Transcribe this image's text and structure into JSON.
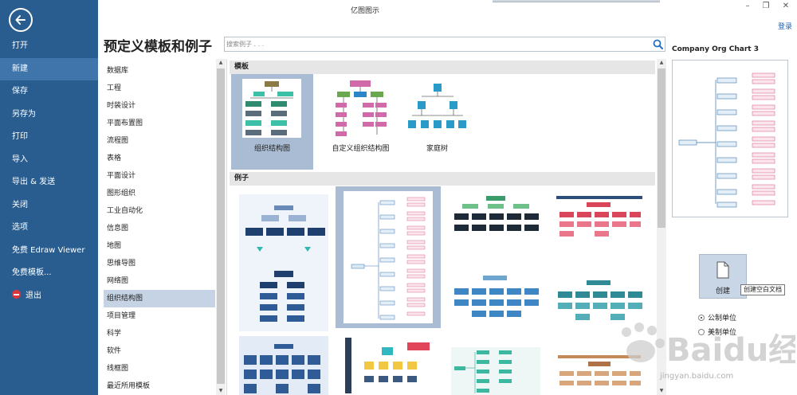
{
  "window": {
    "title": "亿图图示",
    "login": "登录"
  },
  "menu": {
    "items": [
      {
        "label": "打开"
      },
      {
        "label": "新建"
      },
      {
        "label": "保存"
      },
      {
        "label": "另存为"
      },
      {
        "label": "打印"
      },
      {
        "label": "导入"
      },
      {
        "label": "导出 & 发送"
      },
      {
        "label": "关闭"
      },
      {
        "label": "选项"
      },
      {
        "label": "免费 Edraw Viewer"
      },
      {
        "label": "免费模板..."
      },
      {
        "label": "退出"
      }
    ],
    "active_index": 1
  },
  "heading": "预定义模板和例子",
  "search": {
    "placeholder": "搜索例子 . . ."
  },
  "categories": {
    "items": [
      "数据库",
      "工程",
      "时装设计",
      "平面布置图",
      "流程图",
      "表格",
      "平面设计",
      "图形组织",
      "工业自动化",
      "信息图",
      "地图",
      "思维导图",
      "网络图",
      "组织结构图",
      "项目管理",
      "科学",
      "软件",
      "线框图",
      "最近所用模板"
    ],
    "selected": "组织结构图"
  },
  "templates": {
    "header": "模板",
    "items": [
      {
        "label": "组织结构图"
      },
      {
        "label": "自定义组织结构图"
      },
      {
        "label": "家庭树"
      }
    ]
  },
  "examples": {
    "header": "例子"
  },
  "preview": {
    "title": "Company Org Chart 3",
    "create_label": "创建",
    "create_tooltip": "创建空白文档",
    "unit_metric": "公制单位",
    "unit_us": "美制单位"
  },
  "watermark": {
    "text": "Baidu经验",
    "url": "jingyan.baidu.com"
  },
  "colors": {
    "sidebar": "#2a5d8f",
    "selection": "#a9bcd3",
    "link": "#1c64b8"
  }
}
